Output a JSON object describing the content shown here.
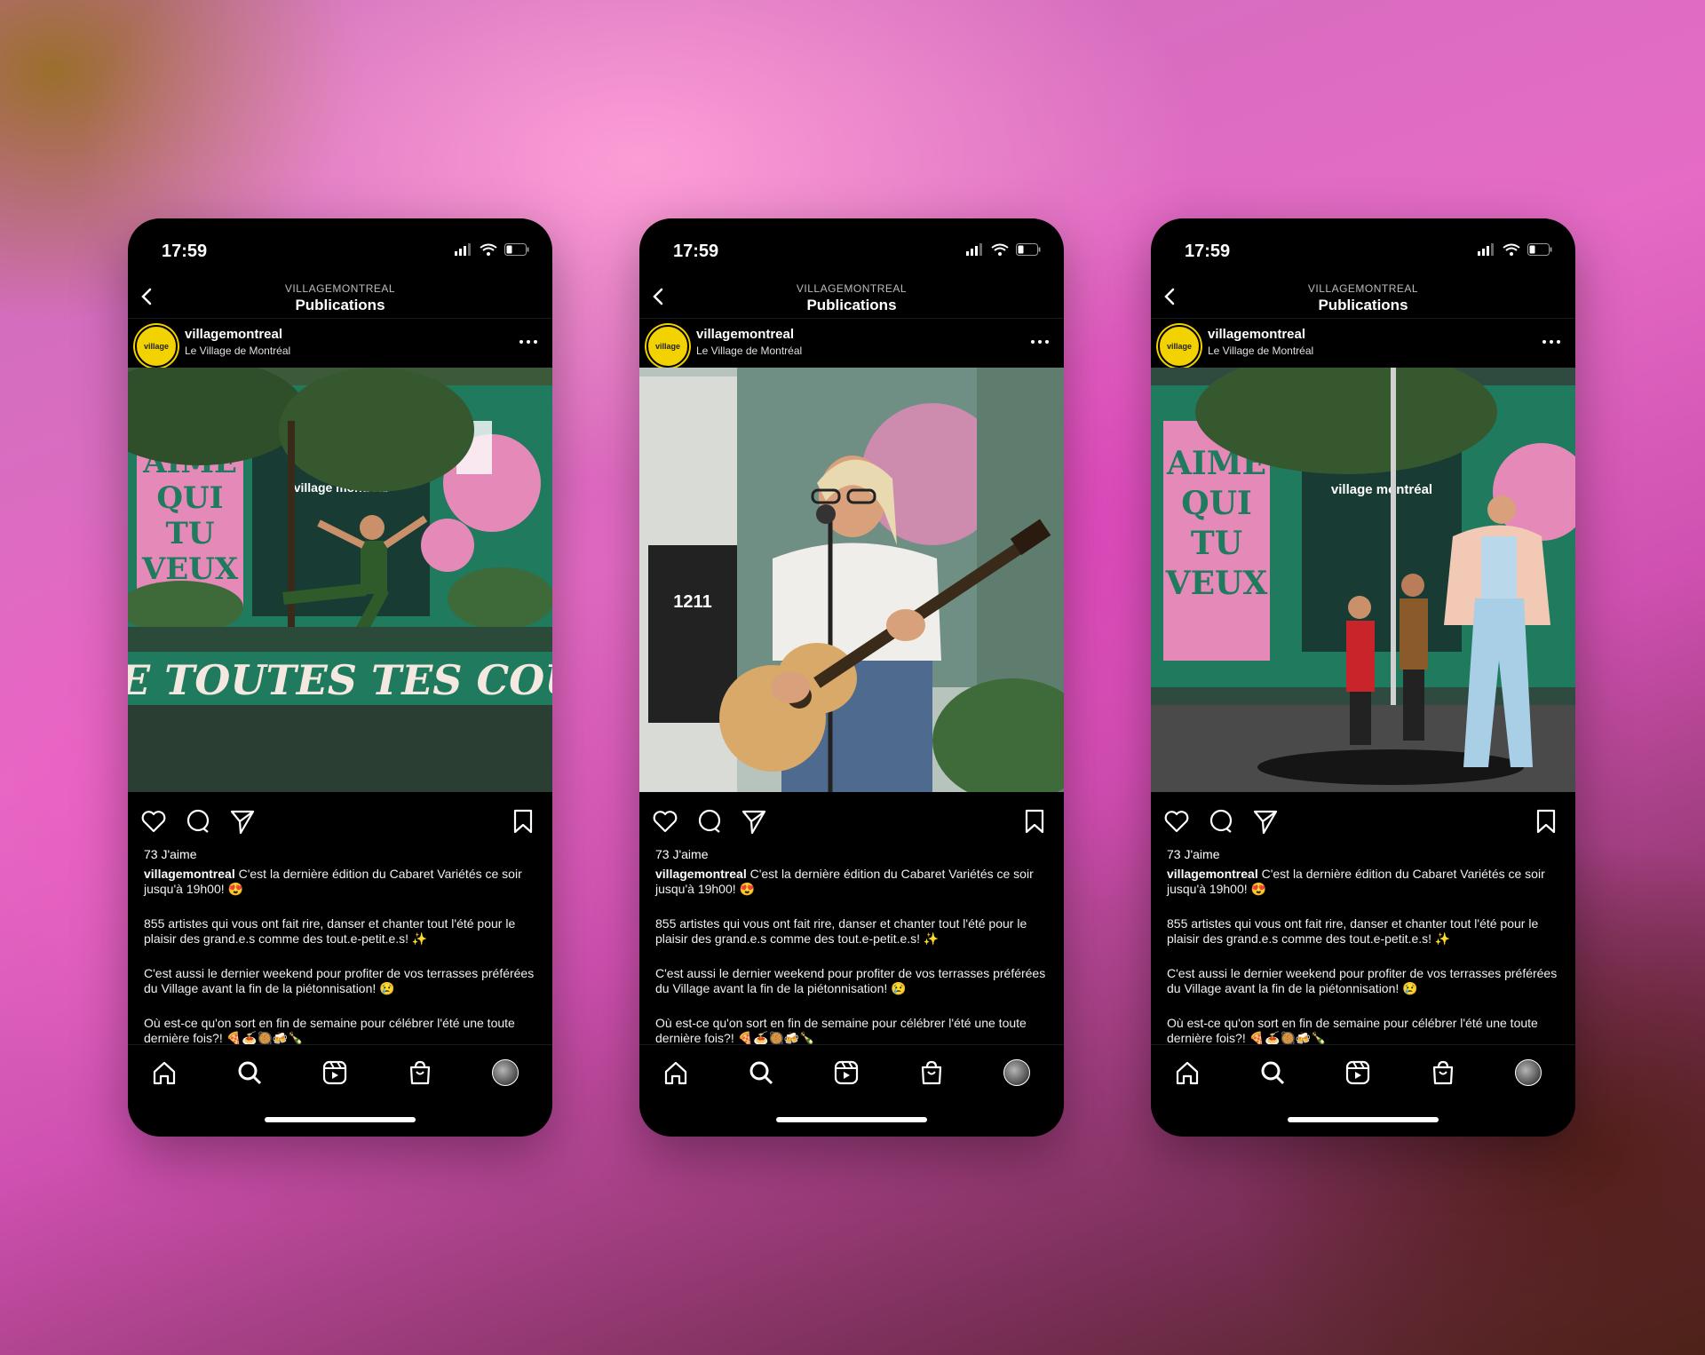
{
  "phones": [
    {
      "status": {
        "time": "17:59"
      },
      "nav": {
        "account": "VILLAGEMONTREAL",
        "title": "Publications"
      },
      "post": {
        "username": "villagemontreal",
        "location": "Le Village de Montréal",
        "avatar_text": "village",
        "photo": {
          "sign": "village montréal",
          "banner": "E TOUTES TES COUL",
          "mural": "AIME QUI TU VEUX"
        },
        "likes": "73 J'aime",
        "caption_lead": "C'est la dernière édition du Cabaret Variétés ce soir jusqu'à 19h00! 😍",
        "caption_p2": "855 artistes qui vous ont fait rire, danser et chanter tout l'été pour le plaisir des grand.e.s comme des tout.e-petit.e.s! ✨",
        "caption_p3": "C'est aussi le dernier weekend pour profiter de vos terrasses préférées du Village avant la fin de la piétonnisation! 😢",
        "caption_p4": "Où est-ce qu'on sort en fin de semaine pour célébrer l'été une toute dernière fois?! 🍕🍝🥘🍻🍾"
      }
    },
    {
      "status": {
        "time": "17:59"
      },
      "nav": {
        "account": "VILLAGEMONTREAL",
        "title": "Publications"
      },
      "post": {
        "username": "villagemontreal",
        "location": "Le Village de Montréal",
        "avatar_text": "village",
        "photo": {
          "sign": "1211"
        },
        "likes": "73 J'aime",
        "caption_lead": "C'est la dernière édition du Cabaret Variétés ce soir jusqu'à 19h00! 😍",
        "caption_p2": "855 artistes qui vous ont fait rire, danser et chanter tout l'été pour le plaisir des grand.e.s comme des tout.e-petit.e.s! ✨",
        "caption_p3": "C'est aussi le dernier weekend pour profiter de vos terrasses préférées du Village avant la fin de la piétonnisation! 😢",
        "caption_p4": "Où est-ce qu'on sort en fin de semaine pour célébrer l'été une toute dernière fois?! 🍕🍝🥘🍻🍾"
      }
    },
    {
      "status": {
        "time": "17:59"
      },
      "nav": {
        "account": "VILLAGEMONTREAL",
        "title": "Publications"
      },
      "post": {
        "username": "villagemontreal",
        "location": "Le Village de Montréal",
        "avatar_text": "village",
        "photo": {
          "sign": "village montréal",
          "mural": "AIME QUI TU VEUX"
        },
        "likes": "73 J'aime",
        "caption_lead": "C'est la dernière édition du Cabaret Variétés ce soir jusqu'à 19h00! 😍",
        "caption_p2": "855 artistes qui vous ont fait rire, danser et chanter tout l'été pour le plaisir des grand.e.s comme des tout.e-petit.e.s! ✨",
        "caption_p3": "C'est aussi le dernier weekend pour profiter de vos terrasses préférées du Village avant la fin de la piétonnisation! 😢",
        "caption_p4": "Où est-ce qu'on sort en fin de semaine pour célébrer l'été une toute dernière fois?! 🍕🍝🥘🍻🍾"
      }
    }
  ],
  "colors": {
    "background_pink": "#e56bc5",
    "mural_green": "#1f7a5e",
    "mural_pink": "#e58ab8",
    "avatar_yellow": "#f2d200"
  },
  "icons": [
    "chevron-left-icon",
    "more-icon",
    "heart-icon",
    "comment-icon",
    "share-icon",
    "bookmark-icon",
    "home-icon",
    "search-icon",
    "reels-icon",
    "shop-icon",
    "profile-icon",
    "signal-icon",
    "wifi-icon",
    "battery-icon"
  ]
}
